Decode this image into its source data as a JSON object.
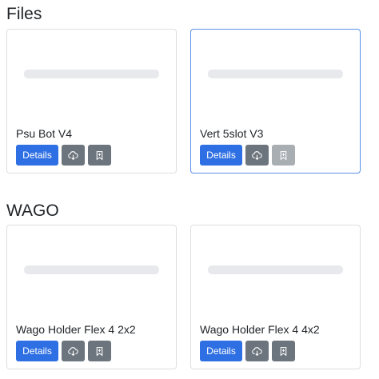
{
  "sections": [
    {
      "title": "Files",
      "cards": [
        {
          "name": "Psu Bot V4",
          "details_label": "Details"
        },
        {
          "name": "Vert 5slot V3",
          "details_label": "Details"
        }
      ]
    },
    {
      "title": "WAGO",
      "cards": [
        {
          "name": "Wago Holder Flex 4 2x2",
          "details_label": "Details"
        },
        {
          "name": "Wago Holder Flex 4 4x2",
          "details_label": "Details"
        }
      ]
    }
  ],
  "icons": {
    "download": "cloud-download-icon",
    "bookmark": "bookmark-icon"
  },
  "colors": {
    "primary": "#2e6fe3",
    "secondary": "#6c757d",
    "selected_border": "#5b8fe8"
  }
}
